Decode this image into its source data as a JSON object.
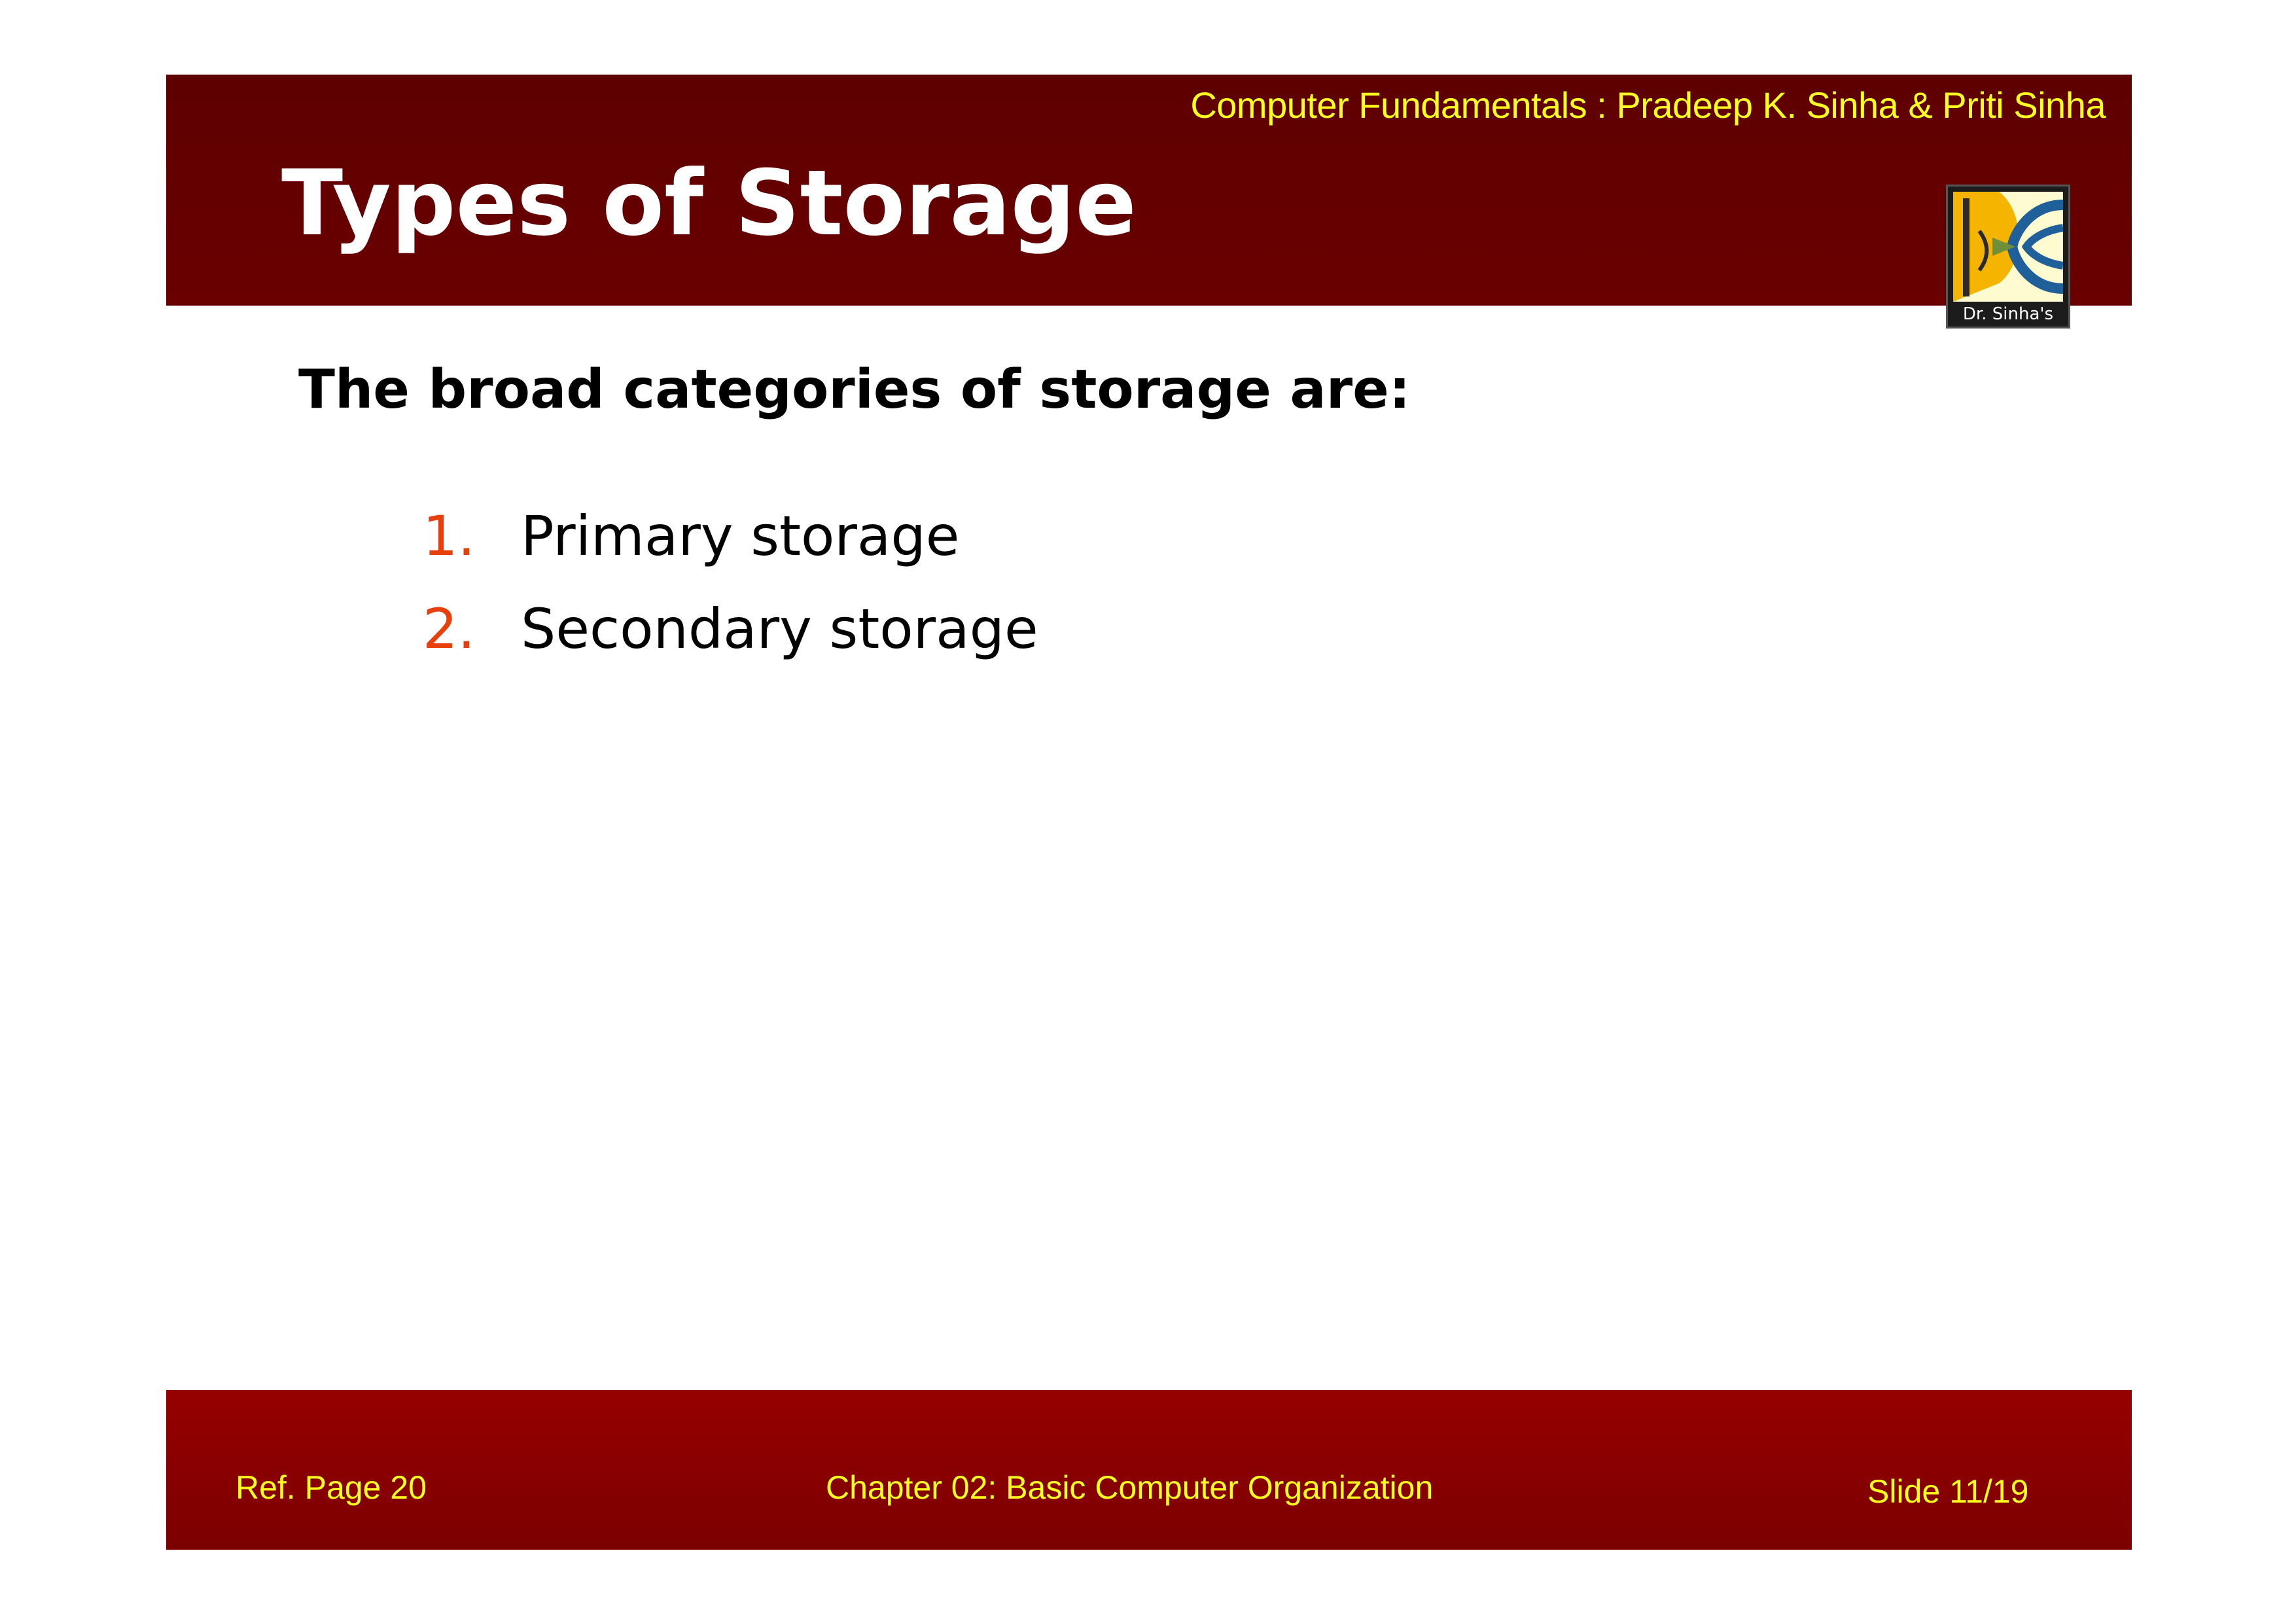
{
  "header": {
    "book_credit": "Computer Fundamentals : Pradeep K. Sinha & Priti Sinha",
    "title": "Types of Storage",
    "logo_caption": "Dr. Sinha's"
  },
  "content": {
    "intro": "The broad categories of storage are:",
    "categories": [
      {
        "number": "1.",
        "label": "Primary storage"
      },
      {
        "number": "2.",
        "label": "Secondary storage"
      }
    ]
  },
  "footer": {
    "ref_page": "Ref. Page  20",
    "chapter": "Chapter 02: Basic Computer Organization",
    "slide": "Slide 11/19"
  },
  "colors": {
    "header_band": "#640000",
    "footer_band": "#8a0000",
    "highlight_text": "#ffff1f",
    "list_number": "#e8400c"
  }
}
